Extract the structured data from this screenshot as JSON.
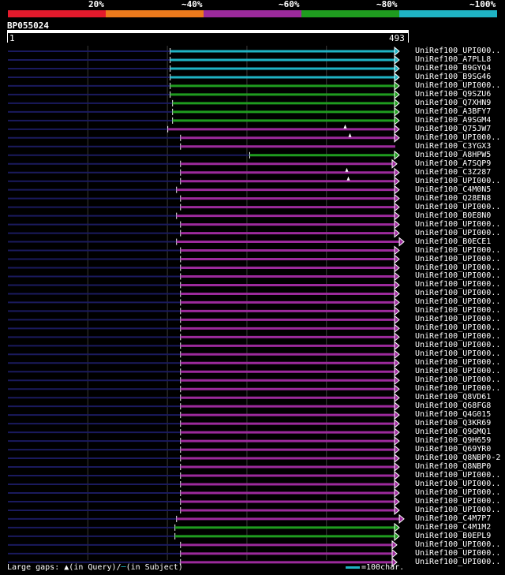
{
  "header": {
    "pct_labels": [
      "20%",
      "~40%",
      "~60%",
      "~80%",
      "~100%"
    ],
    "band_colors": [
      "#e31a2c",
      "#ec7a1c",
      "#9c2a9c",
      "#1f9c1f",
      "#1fb3c4"
    ]
  },
  "query": {
    "id": "BP055024",
    "start": "1",
    "end": "493",
    "length": 493
  },
  "legend": {
    "gaps_text": "Large gaps:",
    "query_gap_symbol": "▲",
    "query_gap_text": "(in Query)/",
    "subject_gap_symbol": "─",
    "subject_gap_text": "(in Subject)",
    "scale_text": "=100char."
  },
  "chart_data": {
    "type": "alignment",
    "xlim": [
      1,
      493
    ],
    "identity_colors": {
      "cyan": "#1fb3c4",
      "green": "#1f9c1f",
      "purple": "#9c2a9c",
      "dark": "#1a1a5e"
    },
    "hits": [
      {
        "name": "UniRef100_UPI000..",
        "color": "cyan",
        "start": 205,
        "end": 493,
        "arrow": "right",
        "gaps": []
      },
      {
        "name": "UniRef100_A7PLL8",
        "color": "cyan",
        "start": 205,
        "end": 493,
        "arrow": "right",
        "gaps": []
      },
      {
        "name": "UniRef100_B9GYQ4",
        "color": "cyan",
        "start": 205,
        "end": 493,
        "arrow": "right",
        "gaps": []
      },
      {
        "name": "UniRef100_B9SG46",
        "color": "cyan",
        "start": 205,
        "end": 493,
        "arrow": "right",
        "gaps": []
      },
      {
        "name": "UniRef100_UPI000..",
        "color": "green",
        "start": 205,
        "end": 493,
        "arrow": "right",
        "gaps": []
      },
      {
        "name": "UniRef100_Q9SZU6",
        "color": "green",
        "start": 205,
        "end": 493,
        "arrow": "right",
        "gaps": []
      },
      {
        "name": "UniRef100_Q7XHN9",
        "color": "green",
        "start": 208,
        "end": 493,
        "arrow": "right",
        "gaps": []
      },
      {
        "name": "UniRef100_A3BFY7",
        "color": "green",
        "start": 208,
        "end": 493,
        "arrow": "right",
        "gaps": []
      },
      {
        "name": "UniRef100_A9SGM4",
        "color": "green",
        "start": 208,
        "end": 493,
        "arrow": "right",
        "gaps": []
      },
      {
        "name": "UniRef100_Q75JW7",
        "color": "purple",
        "start": 202,
        "end": 493,
        "arrow": "right",
        "gaps": [
          425
        ]
      },
      {
        "name": "UniRef100_UPI000..",
        "color": "purple",
        "start": 218,
        "end": 493,
        "arrow": "right",
        "gaps": [
          431
        ]
      },
      {
        "name": "UniRef100_C3YGX3",
        "color": "purple",
        "start": 218,
        "end": 493,
        "arrow": "none",
        "gaps": []
      },
      {
        "name": "UniRef100_A8HPW5",
        "color": "green",
        "start": 305,
        "end": 493,
        "arrow": "right",
        "gaps": []
      },
      {
        "name": "UniRef100_A7SQP9",
        "color": "purple",
        "start": 218,
        "end": 490,
        "arrow": "right",
        "gaps": []
      },
      {
        "name": "UniRef100_C3Z287",
        "color": "purple",
        "start": 218,
        "end": 493,
        "arrow": "right",
        "gaps": [
          427
        ]
      },
      {
        "name": "UniRef100_UPI000..",
        "color": "purple",
        "start": 218,
        "end": 493,
        "arrow": "right",
        "gaps": [
          429
        ]
      },
      {
        "name": "UniRef100_C4M0N5",
        "color": "purple",
        "start": 213,
        "end": 493,
        "arrow": "right",
        "gaps": []
      },
      {
        "name": "UniRef100_Q28EN8",
        "color": "purple",
        "start": 218,
        "end": 493,
        "arrow": "right",
        "gaps": []
      },
      {
        "name": "UniRef100_UPI000..",
        "color": "purple",
        "start": 218,
        "end": 493,
        "arrow": "right",
        "gaps": []
      },
      {
        "name": "UniRef100_B0E8N0",
        "color": "purple",
        "start": 213,
        "end": 493,
        "arrow": "right",
        "gaps": []
      },
      {
        "name": "UniRef100_UPI000..",
        "color": "purple",
        "start": 218,
        "end": 493,
        "arrow": "right",
        "gaps": []
      },
      {
        "name": "UniRef100_UPI000..",
        "color": "purple",
        "start": 218,
        "end": 493,
        "arrow": "right",
        "gaps": []
      },
      {
        "name": "UniRef100_B0ECE1",
        "color": "purple",
        "start": 213,
        "end": 499,
        "arrow": "right",
        "gaps": []
      },
      {
        "name": "UniRef100_UPI000..",
        "color": "purple",
        "start": 218,
        "end": 493,
        "arrow": "right",
        "gaps": []
      },
      {
        "name": "UniRef100_UPI000..",
        "color": "purple",
        "start": 218,
        "end": 493,
        "arrow": "right",
        "gaps": []
      },
      {
        "name": "UniRef100_UPI000..",
        "color": "purple",
        "start": 218,
        "end": 493,
        "arrow": "right",
        "gaps": []
      },
      {
        "name": "UniRef100_UPI000..",
        "color": "purple",
        "start": 218,
        "end": 493,
        "arrow": "right",
        "gaps": []
      },
      {
        "name": "UniRef100_UPI000..",
        "color": "purple",
        "start": 218,
        "end": 493,
        "arrow": "right",
        "gaps": []
      },
      {
        "name": "UniRef100_UPI000..",
        "color": "purple",
        "start": 218,
        "end": 493,
        "arrow": "right",
        "gaps": []
      },
      {
        "name": "UniRef100_UPI000..",
        "color": "purple",
        "start": 218,
        "end": 493,
        "arrow": "right",
        "gaps": []
      },
      {
        "name": "UniRef100_UPI000..",
        "color": "purple",
        "start": 218,
        "end": 493,
        "arrow": "right",
        "gaps": []
      },
      {
        "name": "UniRef100_UPI000..",
        "color": "purple",
        "start": 218,
        "end": 493,
        "arrow": "right",
        "gaps": []
      },
      {
        "name": "UniRef100_UPI000..",
        "color": "purple",
        "start": 218,
        "end": 493,
        "arrow": "right",
        "gaps": []
      },
      {
        "name": "UniRef100_UPI000..",
        "color": "purple",
        "start": 218,
        "end": 493,
        "arrow": "right",
        "gaps": []
      },
      {
        "name": "UniRef100_UPI000..",
        "color": "purple",
        "start": 218,
        "end": 493,
        "arrow": "right",
        "gaps": []
      },
      {
        "name": "UniRef100_UPI000..",
        "color": "purple",
        "start": 218,
        "end": 493,
        "arrow": "right",
        "gaps": []
      },
      {
        "name": "UniRef100_UPI000..",
        "color": "purple",
        "start": 218,
        "end": 493,
        "arrow": "right",
        "gaps": []
      },
      {
        "name": "UniRef100_UPI000..",
        "color": "purple",
        "start": 218,
        "end": 493,
        "arrow": "right",
        "gaps": []
      },
      {
        "name": "UniRef100_UPI000..",
        "color": "purple",
        "start": 218,
        "end": 493,
        "arrow": "right",
        "gaps": []
      },
      {
        "name": "UniRef100_UPI000..",
        "color": "purple",
        "start": 218,
        "end": 493,
        "arrow": "right",
        "gaps": []
      },
      {
        "name": "UniRef100_Q8VD61",
        "color": "purple",
        "start": 218,
        "end": 493,
        "arrow": "right",
        "gaps": []
      },
      {
        "name": "UniRef100_Q68FG8",
        "color": "purple",
        "start": 218,
        "end": 493,
        "arrow": "right",
        "gaps": []
      },
      {
        "name": "UniRef100_Q4G015",
        "color": "purple",
        "start": 218,
        "end": 493,
        "arrow": "right",
        "gaps": []
      },
      {
        "name": "UniRef100_Q3KR69",
        "color": "purple",
        "start": 218,
        "end": 493,
        "arrow": "right",
        "gaps": []
      },
      {
        "name": "UniRef100_Q9GMQ1",
        "color": "purple",
        "start": 218,
        "end": 493,
        "arrow": "right",
        "gaps": []
      },
      {
        "name": "UniRef100_Q9H659",
        "color": "purple",
        "start": 218,
        "end": 493,
        "arrow": "right",
        "gaps": []
      },
      {
        "name": "UniRef100_Q69YR0",
        "color": "purple",
        "start": 218,
        "end": 493,
        "arrow": "right",
        "gaps": []
      },
      {
        "name": "UniRef100_Q8NBP0-2",
        "color": "purple",
        "start": 218,
        "end": 493,
        "arrow": "right",
        "gaps": []
      },
      {
        "name": "UniRef100_Q8NBP0",
        "color": "purple",
        "start": 218,
        "end": 493,
        "arrow": "right",
        "gaps": []
      },
      {
        "name": "UniRef100_UPI000..",
        "color": "purple",
        "start": 218,
        "end": 493,
        "arrow": "right",
        "gaps": []
      },
      {
        "name": "UniRef100_UPI000..",
        "color": "purple",
        "start": 218,
        "end": 493,
        "arrow": "right",
        "gaps": []
      },
      {
        "name": "UniRef100_UPI000..",
        "color": "purple",
        "start": 218,
        "end": 493,
        "arrow": "right",
        "gaps": []
      },
      {
        "name": "UniRef100_UPI000..",
        "color": "purple",
        "start": 218,
        "end": 493,
        "arrow": "right",
        "gaps": []
      },
      {
        "name": "UniRef100_UPI000..",
        "color": "purple",
        "start": 218,
        "end": 493,
        "arrow": "right",
        "gaps": []
      },
      {
        "name": "UniRef100_C4M7P7",
        "color": "purple",
        "start": 213,
        "end": 499,
        "arrow": "right",
        "gaps": []
      },
      {
        "name": "UniRef100_C4M1M2",
        "color": "green",
        "start": 211,
        "end": 493,
        "arrow": "right",
        "gaps": []
      },
      {
        "name": "UniRef100_B0EPL9",
        "color": "green",
        "start": 211,
        "end": 493,
        "arrow": "right",
        "gaps": []
      },
      {
        "name": "UniRef100_UPI000..",
        "color": "purple",
        "start": 218,
        "end": 490,
        "arrow": "right",
        "gaps": []
      },
      {
        "name": "UniRef100_UPI000..",
        "color": "purple",
        "start": 218,
        "end": 490,
        "arrow": "right",
        "gaps": []
      },
      {
        "name": "UniRef100_UPI000..",
        "color": "purple",
        "start": 218,
        "end": 490,
        "arrow": "right",
        "gaps": []
      }
    ]
  }
}
